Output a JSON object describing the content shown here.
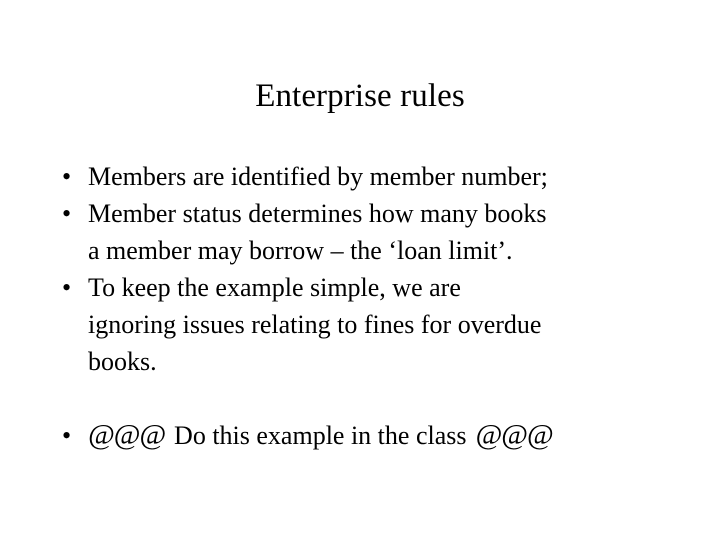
{
  "slide": {
    "title": "Enterprise rules",
    "background_color": "#ffffff",
    "text_color": "#000000",
    "bullet_marker": "•",
    "bullets": [
      {
        "lines": [
          "Members are identified by member number;"
        ]
      },
      {
        "lines": [
          "Member status determines how many books",
          "a member may borrow – the ‘loan limit’."
        ]
      },
      {
        "lines": [
          "To keep the example simple, we are",
          "ignoring issues relating to fines for overdue",
          "books."
        ]
      },
      {
        "symbol_prefix": "@@@",
        "lines": [
          "Do this example in the class"
        ],
        "symbol_suffix": "@@@"
      }
    ]
  }
}
